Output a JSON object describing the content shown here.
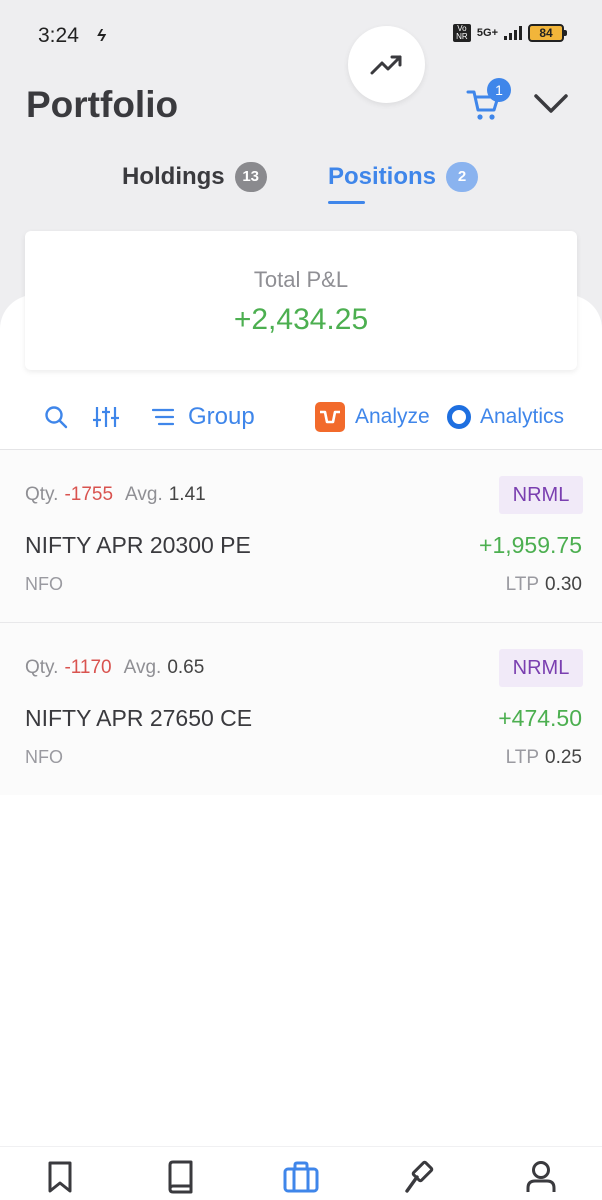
{
  "status_bar": {
    "time": "3:24",
    "network": "5G+",
    "volte": "Vo NR",
    "battery": "84"
  },
  "header": {
    "title": "Portfolio",
    "cart_count": "1"
  },
  "tabs": [
    {
      "label": "Holdings",
      "count": "13",
      "active": false
    },
    {
      "label": "Positions",
      "count": "2",
      "active": true
    }
  ],
  "summary": {
    "label": "Total P&L",
    "value": "+2,434.25"
  },
  "toolbar": {
    "group_label": "Group",
    "analyze_label": "Analyze",
    "analytics_label": "Analytics"
  },
  "positions": [
    {
      "qty_label": "Qty.",
      "qty": "-1755",
      "avg_label": "Avg.",
      "avg": "1.41",
      "product": "NRML",
      "symbol": "NIFTY APR 20300 PE",
      "pnl": "+1,959.75",
      "exchange": "NFO",
      "ltp_label": "LTP",
      "ltp": "0.30"
    },
    {
      "qty_label": "Qty.",
      "qty": "-1170",
      "avg_label": "Avg.",
      "avg": "0.65",
      "product": "NRML",
      "symbol": "NIFTY APR 27650 CE",
      "pnl": "+474.50",
      "exchange": "NFO",
      "ltp_label": "LTP",
      "ltp": "0.25"
    }
  ],
  "bottom_nav": [
    {
      "icon": "bookmark-icon",
      "active": false
    },
    {
      "icon": "book-icon",
      "active": false
    },
    {
      "icon": "briefcase-icon",
      "active": true
    },
    {
      "icon": "gavel-icon",
      "active": false
    },
    {
      "icon": "user-icon",
      "active": false
    }
  ],
  "colors": {
    "accent": "#3f86ea",
    "profit": "#4caf50",
    "loss": "#d9534f",
    "product_badge_text": "#7a3fb0",
    "analyze_brand": "#f26a2b"
  }
}
